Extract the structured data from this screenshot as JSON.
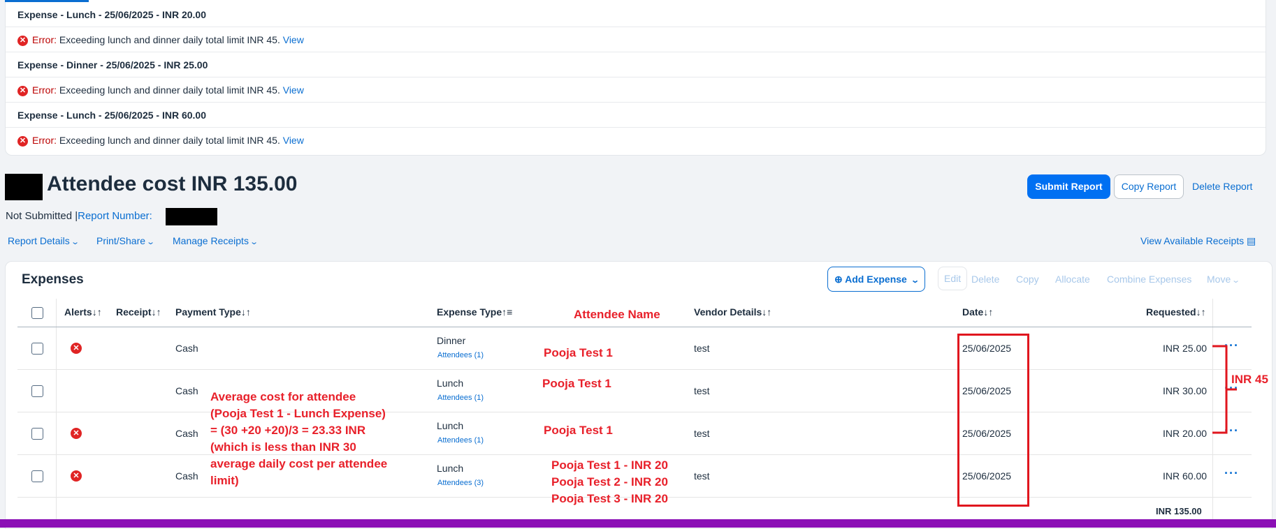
{
  "alerts": [
    {
      "type": "title",
      "text": "Expense - Lunch - 25/06/2025 - INR 20.00"
    },
    {
      "type": "error",
      "label": "Error:",
      "message": "Exceeding lunch and dinner daily total limit INR 45.",
      "link": "View"
    },
    {
      "type": "title",
      "text": "Expense - Dinner - 25/06/2025 - INR 25.00"
    },
    {
      "type": "error",
      "label": "Error:",
      "message": "Exceeding lunch and dinner daily total limit INR 45.",
      "link": "View"
    },
    {
      "type": "title",
      "text": "Expense - Lunch - 25/06/2025 - INR 60.00"
    },
    {
      "type": "error",
      "label": "Error:",
      "message": "Exceeding lunch and dinner daily total limit INR 45.",
      "link": "View"
    }
  ],
  "report": {
    "title": "Attendee cost INR 135.00",
    "status": "Not Submitted |",
    "report_number_label": "Report Number:",
    "buttons": {
      "submit": "Submit Report",
      "copy": "Copy Report",
      "delete": "Delete Report"
    },
    "menus": [
      "Report Details",
      "Print/Share",
      "Manage Receipts"
    ],
    "view_receipts": "View Available Receipts"
  },
  "expenses": {
    "title": "Expenses",
    "toolbar": {
      "add": "Add Expense",
      "edit": "Edit",
      "delete": "Delete",
      "copy": "Copy",
      "allocate": "Allocate",
      "combine": "Combine Expenses",
      "move": "Move"
    },
    "columns": {
      "alerts": "Alerts",
      "receipt": "Receipt",
      "payment_type": "Payment Type",
      "expense_type": "Expense Type",
      "vendor": "Vendor Details",
      "date": "Date",
      "requested": "Requested"
    },
    "rows": [
      {
        "error": true,
        "payment": "Cash",
        "type": "Dinner",
        "attendees": "Attendees (1)",
        "vendor": "test",
        "date": "25/06/2025",
        "amount": "INR 25.00"
      },
      {
        "error": false,
        "payment": "Cash",
        "type": "Lunch",
        "attendees": "Attendees (1)",
        "vendor": "test",
        "date": "25/06/2025",
        "amount": "INR 30.00"
      },
      {
        "error": true,
        "payment": "Cash",
        "type": "Lunch",
        "attendees": "Attendees (1)",
        "vendor": "test",
        "date": "25/06/2025",
        "amount": "INR 20.00"
      },
      {
        "error": true,
        "payment": "Cash",
        "type": "Lunch",
        "attendees": "Attendees (3)",
        "vendor": "test",
        "date": "25/06/2025",
        "amount": "INR 60.00"
      }
    ],
    "total": "INR 135.00"
  },
  "annotations": {
    "attendee_header": "Attendee Name",
    "row_names": [
      "Pooja Test 1",
      "Pooja Test 1",
      "Pooja Test 1"
    ],
    "row4_names": [
      "Pooja Test 1 - INR 20",
      "Pooja Test 2 - INR 20",
      "Pooja Test 3 - INR 20"
    ],
    "average_note": [
      "Average cost for attendee",
      "(Pooja Test 1 - Lunch Expense)",
      "= (30 +20 +20)/3 = 23.33 INR",
      "(which is less than INR 30",
      "average daily cost per attendee",
      "limit)"
    ],
    "bracket_label": "INR 45"
  },
  "colors": {
    "accent": "#0a6ed1",
    "primary_button": "#0070f2",
    "error": "#e02424",
    "annotation": "#e8202a",
    "bottom_bar": "#8b10b5"
  }
}
